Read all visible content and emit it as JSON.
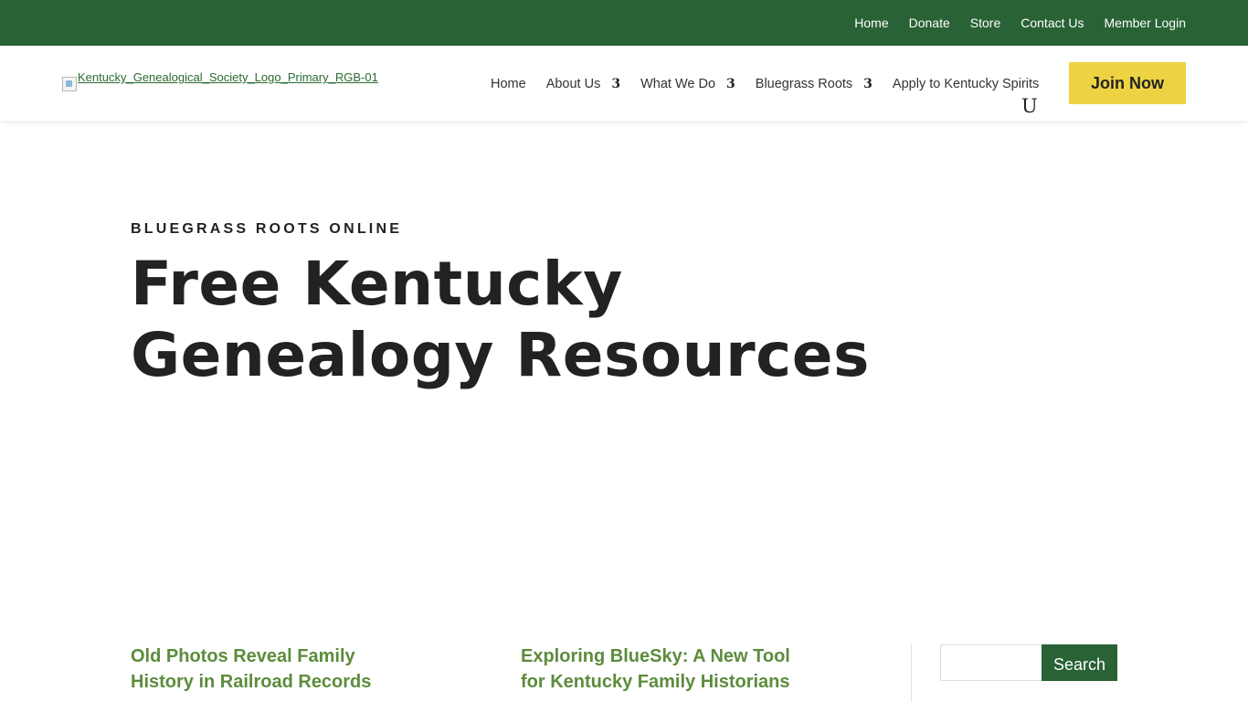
{
  "topbar": {
    "links": [
      "Home",
      "Donate",
      "Store",
      "Contact Us",
      "Member Login"
    ],
    "background": "#296235"
  },
  "header": {
    "logo_alt": "Kentucky_Genealogical_Society_Logo_Primary_RGB-01",
    "nav": [
      {
        "label": "Home"
      },
      {
        "label": "About Us",
        "chevron": "3"
      },
      {
        "label": "What We Do",
        "chevron": "3"
      },
      {
        "label": "Bluegrass Roots",
        "chevron": "3"
      },
      {
        "label": "Apply to Kentucky Spirits"
      }
    ],
    "stray_glyph": "U",
    "join_label": "Join Now",
    "join_color": "#edd344"
  },
  "hero": {
    "kicker": "BLUEGRASS ROOTS ONLINE",
    "title_line1": "Free Kentucky",
    "title_line2": "Genealogy Resources"
  },
  "posts": [
    {
      "title": "Old Photos Reveal Family History in Railroad Records"
    },
    {
      "title": "Exploring BlueSky: A New Tool for Kentucky Family Historians"
    }
  ],
  "sidebar": {
    "search_value": "",
    "search_button": "Search"
  }
}
